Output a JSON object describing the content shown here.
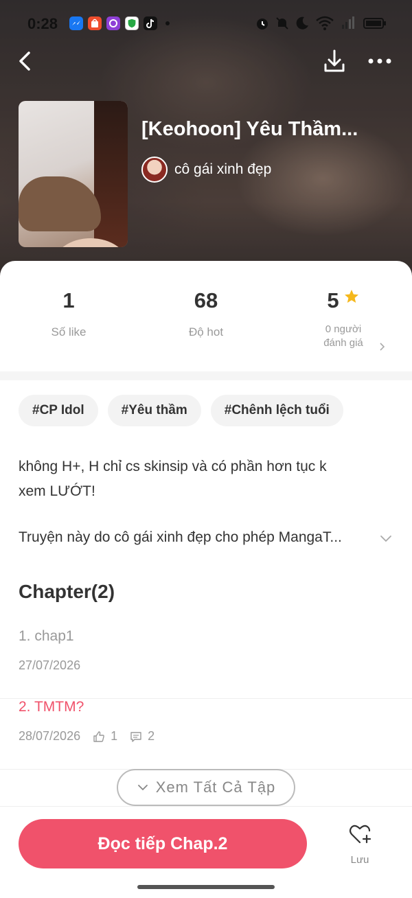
{
  "status_bar": {
    "time": "0:28",
    "notification_icons": [
      "messenger-icon",
      "shopee-icon",
      "app-icon",
      "shield-app-icon",
      "tiktok-icon"
    ],
    "system_icons": [
      "alarm-icon",
      "mute-icon",
      "do-not-disturb-icon",
      "wifi-icon",
      "signal-icon",
      "battery-icon"
    ]
  },
  "top_bar": {
    "icons": [
      "back-icon",
      "download-icon",
      "more-icon"
    ]
  },
  "story": {
    "title": "[Keohoon] Yêu Thầm...",
    "author": "cô gái xinh đẹp"
  },
  "stats": {
    "likes_value": "1",
    "likes_label": "Số like",
    "hot_value": "68",
    "hot_label": "Độ hot",
    "rating_value": "5",
    "rating_count_line1": "0 người",
    "rating_count_line2": "đánh giá"
  },
  "tags": [
    "#CP Idol",
    "#Yêu thầm",
    "#Chênh lệch tuổi"
  ],
  "description": {
    "line1": "không H+, H chỉ cs skinsip và có phần hơn tục k",
    "line2": "xem LƯỚT!",
    "line3": "Truyện này do cô gái xinh đẹp  cho phép MangaT..."
  },
  "chapters": {
    "heading": "Chapter(2)",
    "items": [
      {
        "title": "1. chap1",
        "date": "27/07/2026",
        "likes": "",
        "comments": ""
      },
      {
        "title": "2. TMTM?",
        "date": "28/07/2026",
        "likes": "1",
        "comments": "2"
      }
    ],
    "see_all": "Xem Tất Cả Tập"
  },
  "bottom": {
    "read_button": "Đọc tiếp Chap.2",
    "save_label": "Lưu"
  },
  "colors": {
    "accent": "#f0526b",
    "star": "#f5b81c",
    "read_chapter_title": "#999999"
  }
}
